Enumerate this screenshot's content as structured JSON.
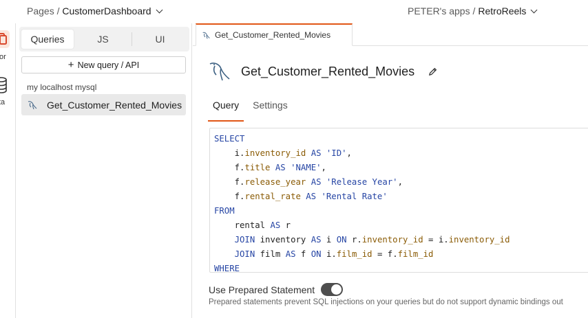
{
  "topbar": {
    "pages_prefix": "Pages /",
    "page_name": "CustomerDashboard",
    "workspace_prefix": "PETER's apps /",
    "app_name": "RetroReels"
  },
  "rail": {
    "editor_label": "tor",
    "data_label": "ta"
  },
  "panel": {
    "tabs": [
      "Queries",
      "JS",
      "UI"
    ],
    "new_query_label": "New query / API",
    "datasource": "my localhost mysql",
    "queries": [
      "Get_Customer_Rented_Movies"
    ]
  },
  "editor": {
    "open_tab": "Get_Customer_Rented_Movies",
    "query_name": "Get_Customer_Rented_Movies",
    "subtabs": [
      "Query",
      "Settings"
    ],
    "prepared_label": "Use Prepared Statement",
    "prepared_enabled": true,
    "prepared_hint": "Prepared statements prevent SQL injections on your queries but do not support dynamic bindings out"
  },
  "sql": {
    "l1": "SELECT",
    "l2a": "i.",
    "l2b": "inventory_id",
    "l2c": "AS",
    "l2d": "'ID'",
    "l3a": "f.",
    "l3b": "title",
    "l3c": "AS",
    "l3d": "'NAME'",
    "l4a": "f.",
    "l4b": "release_year",
    "l4c": "AS",
    "l4d": "'Release Year'",
    "l5a": "f.",
    "l5b": "rental_rate",
    "l5c": "AS",
    "l5d": "'Rental Rate'",
    "l6": "FROM",
    "l7a": "rental",
    "l7b": "AS",
    "l7c": "r",
    "l8a": "JOIN",
    "l8b": "inventory",
    "l8c": "AS",
    "l8d": "i",
    "l8e": "ON",
    "l8f": "r.",
    "l8g": "inventory_id",
    "l8h": "=",
    "l8i": "i.",
    "l8j": "inventory_id",
    "l9a": "JOIN",
    "l9b": "film",
    "l9c": "AS",
    "l9d": "f",
    "l9e": "ON",
    "l9f": "i.",
    "l9g": "film_id",
    "l9h": "=",
    "l9i": "f.",
    "l9j": "film_id",
    "l10": "WHERE"
  },
  "colors": {
    "accent": "#e15615",
    "keyword": "#2645a4",
    "field": "#8a5b05"
  }
}
